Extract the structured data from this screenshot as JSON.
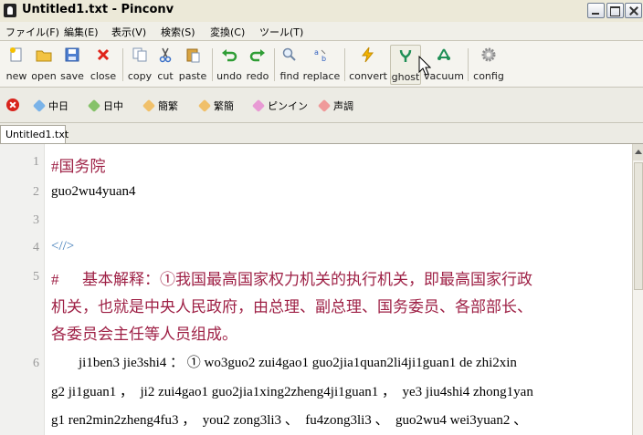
{
  "window": {
    "title": "Untitled1.txt - Pinconv"
  },
  "menu": [
    "ファイル(F)",
    "編集(E)",
    "表示(V)",
    "検索(S)",
    "変換(C)",
    "ツール(T)"
  ],
  "toolbar": [
    {
      "label": "new",
      "icon": "new-file-icon"
    },
    {
      "label": "open",
      "icon": "open-folder-icon"
    },
    {
      "label": "save",
      "icon": "save-disk-icon"
    },
    {
      "label": "close",
      "icon": "close-x-icon"
    },
    {
      "label": "copy",
      "icon": "copy-icon"
    },
    {
      "label": "cut",
      "icon": "cut-scissors-icon"
    },
    {
      "label": "paste",
      "icon": "paste-icon"
    },
    {
      "label": "undo",
      "icon": "undo-arrow-icon"
    },
    {
      "label": "redo",
      "icon": "redo-arrow-icon"
    },
    {
      "label": "find",
      "icon": "magnifier-icon"
    },
    {
      "label": "replace",
      "icon": "replace-icon"
    },
    {
      "label": "convert",
      "icon": "lightning-icon"
    },
    {
      "label": "ghost",
      "icon": "ghost-icon"
    },
    {
      "label": "vacuum",
      "icon": "vacuum-icon"
    },
    {
      "label": "config",
      "icon": "gear-icon"
    }
  ],
  "conversions": [
    "中日",
    "日中",
    "簡繁",
    "繁簡",
    "ピンイン",
    "声調"
  ],
  "tab": {
    "label": "Untitled1.txt"
  },
  "editor": {
    "line_numbers": [
      "1",
      "2",
      "3",
      "4",
      "5",
      "6"
    ],
    "lines": [
      "#国务院",
      "guo2wu4yuan4",
      "",
      "<//>",
      "#      基本解释：①我国最高国家权力机关的执行机关，即最高国家行政",
      "机关，也就是中央人民政府，由总理、副总理、国务委员、各部部长、",
      "各委员会主任等人员组成。",
      "        ji1ben3 jie3shi4 ： ① wo3guo2 zui4gao1 guo2jia1quan2li4ji1guan1 de zhi2xin",
      "g2 ji1guan1 ，  ji2 zui4gao1 guo2jia1xing2zheng4ji1guan1 ，  ye3 jiu4shi4 zhong1yan",
      "g1 ren2min2zheng4fu3 ，  you2 zong3li3 、  fu4zong3li3 、  guo2wu4 wei3yuan2 、"
    ]
  },
  "colors": {
    "text_red": "#9e2045",
    "text_blue": "#3a78b6",
    "close_red": "#d8241c"
  }
}
